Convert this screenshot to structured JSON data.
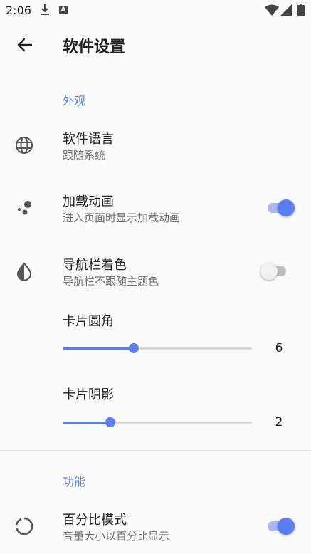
{
  "status_bar": {
    "time": "2:06",
    "a_badge": "A"
  },
  "toolbar": {
    "title": "软件设置"
  },
  "appearance": {
    "section_label": "外观",
    "language": {
      "title": "软件语言",
      "subtitle": "跟随系统"
    },
    "loading_animation": {
      "title": "加载动画",
      "subtitle": "进入页面时显示加载动画",
      "enabled": true
    },
    "navbar_color": {
      "title": "导航栏着色",
      "subtitle": "导航栏不跟随主题色",
      "enabled": false
    },
    "card_radius": {
      "title": "卡片圆角",
      "value": "6",
      "fraction": 0.375
    },
    "card_shadow": {
      "title": "卡片阴影",
      "value": "2",
      "fraction": 0.25
    }
  },
  "features": {
    "section_label": "功能",
    "percent_mode": {
      "title": "百分比模式",
      "subtitle": "音量大小以百分比显示",
      "enabled": true
    }
  },
  "colors": {
    "accent": "#5b7ff0",
    "section_label": "#5b7fcf"
  },
  "icons": [
    "download-icon",
    "a-notification-icon",
    "wifi-icon",
    "cell-signal-icon",
    "battery-icon",
    "back-arrow-icon",
    "globe-icon",
    "dots-icon",
    "contrast-icon",
    "circle-progress-icon"
  ]
}
